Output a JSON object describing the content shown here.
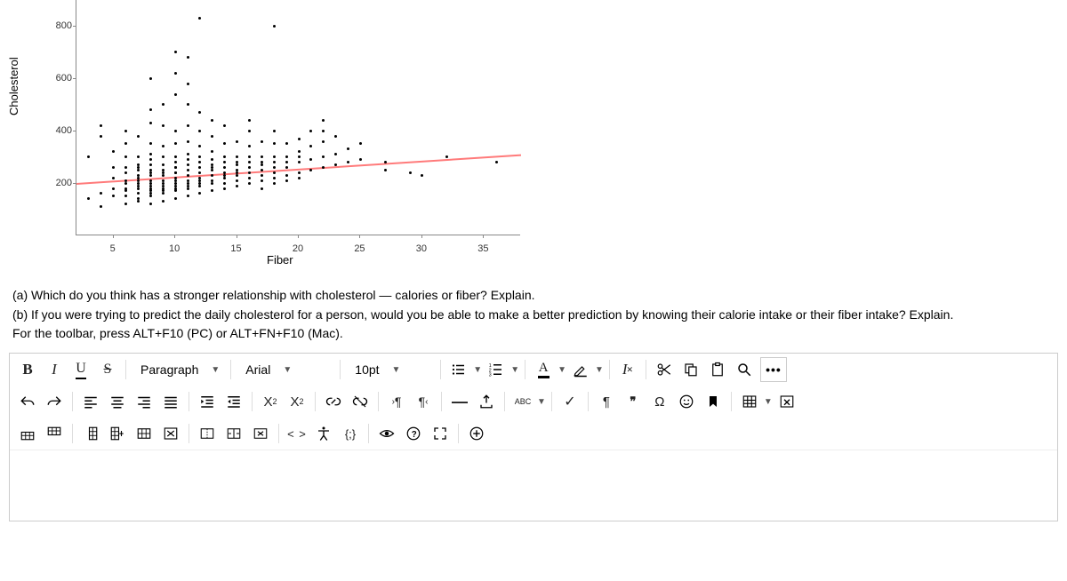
{
  "chart_data": {
    "type": "scatter",
    "title": "",
    "xlabel": "Fiber",
    "ylabel": "Cholesterol",
    "xlim": [
      2,
      38
    ],
    "ylim": [
      0,
      900
    ],
    "xticks": [
      5,
      10,
      15,
      20,
      25,
      30,
      35
    ],
    "yticks": [
      200,
      400,
      600,
      800
    ],
    "trend": {
      "x1": 2,
      "y1": 200,
      "x2": 38,
      "y2": 310
    },
    "points": [
      [
        3,
        140
      ],
      [
        3,
        300
      ],
      [
        4,
        110
      ],
      [
        4,
        160
      ],
      [
        4,
        380
      ],
      [
        4,
        420
      ],
      [
        5,
        180
      ],
      [
        5,
        220
      ],
      [
        5,
        260
      ],
      [
        5,
        150
      ],
      [
        5,
        320
      ],
      [
        6,
        120
      ],
      [
        6,
        180
      ],
      [
        6,
        210
      ],
      [
        6,
        240
      ],
      [
        6,
        260
      ],
      [
        6,
        200
      ],
      [
        6,
        150
      ],
      [
        6,
        300
      ],
      [
        6,
        350
      ],
      [
        6,
        400
      ],
      [
        6,
        170
      ],
      [
        7,
        130
      ],
      [
        7,
        160
      ],
      [
        7,
        190
      ],
      [
        7,
        210
      ],
      [
        7,
        230
      ],
      [
        7,
        250
      ],
      [
        7,
        270
      ],
      [
        7,
        180
      ],
      [
        7,
        300
      ],
      [
        7,
        220
      ],
      [
        7,
        140
      ],
      [
        7,
        260
      ],
      [
        7,
        200
      ],
      [
        7,
        380
      ],
      [
        8,
        120
      ],
      [
        8,
        150
      ],
      [
        8,
        170
      ],
      [
        8,
        190
      ],
      [
        8,
        210
      ],
      [
        8,
        230
      ],
      [
        8,
        250
      ],
      [
        8,
        270
      ],
      [
        8,
        290
      ],
      [
        8,
        310
      ],
      [
        8,
        200
      ],
      [
        8,
        160
      ],
      [
        8,
        180
      ],
      [
        8,
        240
      ],
      [
        8,
        350
      ],
      [
        8,
        430
      ],
      [
        8,
        480
      ],
      [
        8,
        600
      ],
      [
        9,
        130
      ],
      [
        9,
        170
      ],
      [
        9,
        190
      ],
      [
        9,
        210
      ],
      [
        9,
        230
      ],
      [
        9,
        250
      ],
      [
        9,
        270
      ],
      [
        9,
        200
      ],
      [
        9,
        160
      ],
      [
        9,
        180
      ],
      [
        9,
        240
      ],
      [
        9,
        300
      ],
      [
        9,
        340
      ],
      [
        9,
        420
      ],
      [
        9,
        500
      ],
      [
        10,
        140
      ],
      [
        10,
        180
      ],
      [
        10,
        200
      ],
      [
        10,
        220
      ],
      [
        10,
        240
      ],
      [
        10,
        260
      ],
      [
        10,
        280
      ],
      [
        10,
        190
      ],
      [
        10,
        210
      ],
      [
        10,
        170
      ],
      [
        10,
        300
      ],
      [
        10,
        350
      ],
      [
        10,
        400
      ],
      [
        10,
        240
      ],
      [
        10,
        260
      ],
      [
        10,
        540
      ],
      [
        10,
        620
      ],
      [
        10,
        700
      ],
      [
        11,
        150
      ],
      [
        11,
        190
      ],
      [
        11,
        210
      ],
      [
        11,
        230
      ],
      [
        11,
        250
      ],
      [
        11,
        270
      ],
      [
        11,
        290
      ],
      [
        11,
        200
      ],
      [
        11,
        180
      ],
      [
        11,
        310
      ],
      [
        11,
        360
      ],
      [
        11,
        420
      ],
      [
        11,
        500
      ],
      [
        11,
        580
      ],
      [
        11,
        680
      ],
      [
        12,
        160
      ],
      [
        12,
        200
      ],
      [
        12,
        220
      ],
      [
        12,
        240
      ],
      [
        12,
        260
      ],
      [
        12,
        280
      ],
      [
        12,
        190
      ],
      [
        12,
        210
      ],
      [
        12,
        300
      ],
      [
        12,
        340
      ],
      [
        12,
        400
      ],
      [
        12,
        470
      ],
      [
        12,
        830
      ],
      [
        13,
        170
      ],
      [
        13,
        210
      ],
      [
        13,
        230
      ],
      [
        13,
        250
      ],
      [
        13,
        270
      ],
      [
        13,
        290
      ],
      [
        13,
        200
      ],
      [
        13,
        320
      ],
      [
        13,
        380
      ],
      [
        13,
        440
      ],
      [
        13,
        260
      ],
      [
        14,
        180
      ],
      [
        14,
        220
      ],
      [
        14,
        240
      ],
      [
        14,
        260
      ],
      [
        14,
        280
      ],
      [
        14,
        200
      ],
      [
        14,
        300
      ],
      [
        14,
        350
      ],
      [
        14,
        420
      ],
      [
        14,
        230
      ],
      [
        15,
        190
      ],
      [
        15,
        230
      ],
      [
        15,
        250
      ],
      [
        15,
        270
      ],
      [
        15,
        210
      ],
      [
        15,
        300
      ],
      [
        15,
        360
      ],
      [
        15,
        240
      ],
      [
        15,
        280
      ],
      [
        16,
        200
      ],
      [
        16,
        240
      ],
      [
        16,
        260
      ],
      [
        16,
        220
      ],
      [
        16,
        300
      ],
      [
        16,
        340
      ],
      [
        16,
        280
      ],
      [
        16,
        400
      ],
      [
        16,
        440
      ],
      [
        17,
        210
      ],
      [
        17,
        250
      ],
      [
        17,
        270
      ],
      [
        17,
        230
      ],
      [
        17,
        300
      ],
      [
        17,
        360
      ],
      [
        17,
        280
      ],
      [
        17,
        180
      ],
      [
        18,
        220
      ],
      [
        18,
        260
      ],
      [
        18,
        240
      ],
      [
        18,
        300
      ],
      [
        18,
        350
      ],
      [
        18,
        200
      ],
      [
        18,
        280
      ],
      [
        18,
        400
      ],
      [
        18,
        800
      ],
      [
        19,
        230
      ],
      [
        19,
        260
      ],
      [
        19,
        300
      ],
      [
        19,
        350
      ],
      [
        19,
        210
      ],
      [
        19,
        280
      ],
      [
        20,
        240
      ],
      [
        20,
        280
      ],
      [
        20,
        320
      ],
      [
        20,
        370
      ],
      [
        20,
        220
      ],
      [
        20,
        300
      ],
      [
        21,
        250
      ],
      [
        21,
        290
      ],
      [
        21,
        340
      ],
      [
        21,
        400
      ],
      [
        22,
        260
      ],
      [
        22,
        300
      ],
      [
        22,
        360
      ],
      [
        22,
        400
      ],
      [
        22,
        440
      ],
      [
        23,
        270
      ],
      [
        23,
        310
      ],
      [
        23,
        380
      ],
      [
        24,
        280
      ],
      [
        24,
        330
      ],
      [
        25,
        290
      ],
      [
        25,
        350
      ],
      [
        27,
        280
      ],
      [
        27,
        250
      ],
      [
        29,
        240
      ],
      [
        30,
        230
      ],
      [
        32,
        300
      ],
      [
        36,
        280
      ]
    ]
  },
  "questions": {
    "a": "(a)  Which do you think has a stronger relationship with cholesterol — calories or fiber? Explain.",
    "b": "(b) If you were trying to predict the daily cholesterol for a person, would you be able to make a better prediction by knowing their calorie intake or their fiber intake?  Explain.",
    "hint": "For the toolbar, press ALT+F10 (PC) or ALT+FN+F10 (Mac)."
  },
  "toolbar": {
    "bold": "B",
    "italic": "I",
    "underline": "U",
    "strike": "S",
    "block_format": "Paragraph",
    "font_family": "Arial",
    "font_size": "10pt",
    "superscript": "X",
    "subscript": "X",
    "abc": "ABC",
    "paragraph_mark": "¶",
    "quote_mark": "❝❞",
    "omega": "Ω",
    "clear_fmt": "I",
    "code_braces": "{;}",
    "angle_brackets": "< >",
    "ltr": "¶",
    "rtl": "¶",
    "text_color_letter": "A",
    "more": "•••"
  }
}
